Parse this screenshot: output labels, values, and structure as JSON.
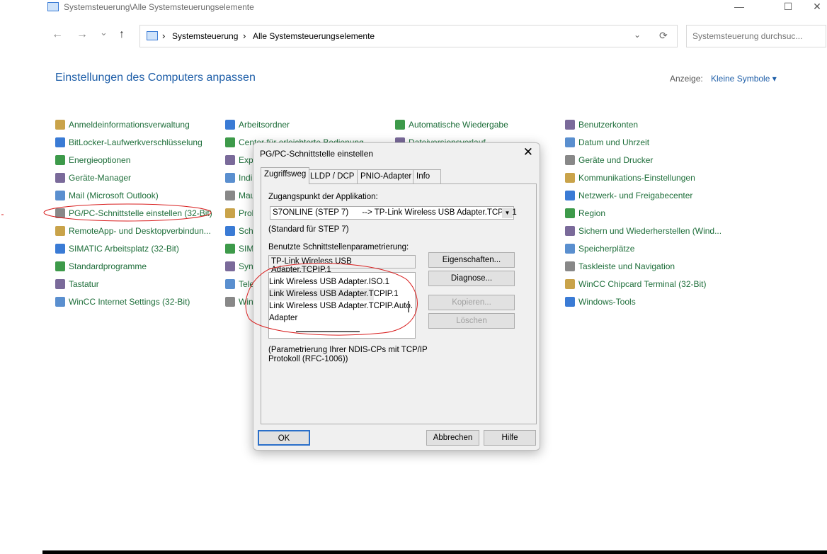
{
  "window": {
    "title": "Systemsteuerung\\Alle Systemsteuerungselemente",
    "min": "—",
    "max": "☐",
    "close": "✕"
  },
  "nav": {
    "back": "←",
    "forward": "→",
    "recent": "⌄",
    "up": "↑",
    "refresh": "⟳",
    "dropdown": "⌄"
  },
  "breadcrumb": [
    "Systemsteuerung",
    "Alle Systemsteuerungselemente"
  ],
  "breadcrumb_sep": "›",
  "search": {
    "placeholder": "Systemsteuerung durchsuc..."
  },
  "page": {
    "heading": "Einstellungen des Computers anpassen",
    "view_label": "Anzeige:",
    "view_value": "Kleine Symbole ▾"
  },
  "columns": [
    [
      "Anmeldeinformationsverwaltung",
      "BitLocker-Laufwerkverschlüsselung",
      "Energieoptionen",
      "Geräte-Manager",
      "Mail (Microsoft Outlook)",
      "PG/PC-Schnittstelle einstellen (32-Bit)",
      "RemoteApp- und Desktopverbindun...",
      "SIMATIC Arbeitsplatz (32-Bit)",
      "Standardprogramme",
      "Tastatur",
      "WinCC Internet Settings (32-Bit)"
    ],
    [
      "Arbeitsordner",
      "Center für erleichterte Bedienung",
      "Expl",
      "Indi",
      "Mau",
      "Prol",
      "Sch",
      "SIM",
      "Syn",
      "Tele",
      "Win"
    ],
    [
      "Automatische Wiedergabe",
      "Dateiversionsverlauf"
    ],
    [
      "Benutzerkonten",
      "Datum und Uhrzeit",
      "Geräte und Drucker",
      "Kommunikations-Einstellungen",
      "Netzwerk- und Freigabecenter",
      "Region",
      "Sichern und Wiederherstellen (Wind...",
      "Speicherplätze",
      "Taskleiste und Navigation",
      "WinCC Chipcard Terminal (32-Bit)",
      "Windows-Tools"
    ]
  ],
  "dialog": {
    "title": "PG/PC-Schnittstelle einstellen",
    "close": "✕",
    "tabs": [
      "Zugriffsweg",
      "LLDP / DCP",
      "PNIO-Adapter",
      "Info"
    ],
    "access_label": "Zugangspunkt der Applikation:",
    "access_value": "S7ONLINE (STEP 7)      --> TP-Link Wireless USB Adapter.TCPIP.1",
    "access_note": "(Standard für STEP 7)",
    "param_label": "Benutzte Schnittstellenparametrierung:",
    "param_value": "TP-Link Wireless USB Adapter.TCPIP.1",
    "list": [
      "Link Wireless USB Adapter.ISO.1",
      "Link Wireless USB Adapter.TCPIP.1",
      "Link Wireless USB Adapter.TCPIP.Auto.",
      "Adapter"
    ],
    "selected_index": 1,
    "description": "(Parametrierung Ihrer NDIS-CPs mit TCP/IP Protokoll (RFC-1006))",
    "buttons": {
      "properties": "Eigenschaften...",
      "diagnose": "Diagnose...",
      "copy": "Kopieren...",
      "delete": "Löschen",
      "ok": "OK",
      "cancel": "Abbrechen",
      "help": "Hilfe"
    }
  },
  "colors": {
    "link": "#1e6e3a",
    "heading": "#1e5ea8",
    "annotation": "#d81e1e"
  }
}
